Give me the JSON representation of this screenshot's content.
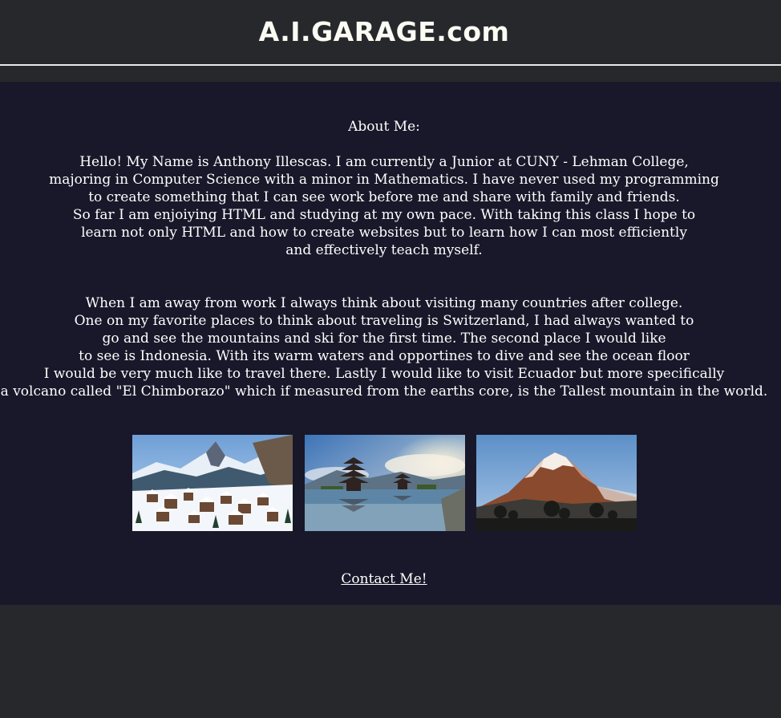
{
  "header": {
    "site_title": "A.I.GARAGE.com"
  },
  "about": {
    "heading": "About Me:",
    "paragraph_1": [
      "Hello! My Name is Anthony Illescas. I am currently a Junior at CUNY - Lehman College,",
      "majoring in Computer Science with a minor in Mathematics. I have never used my programming",
      "to create something that I can see work before me and share with family and friends.",
      "So far I am enjoiying HTML and studying at my own pace. With taking this class I hope to",
      "learn not only HTML and how to create websites but to learn how I can most efficiently",
      "and effectively teach myself."
    ],
    "paragraph_2": [
      "When I am away from work I always think about visiting many countries after college.",
      "One on my favorite places to think about traveling is Switzerland, I had always wanted to",
      "go and see the mountains and ski for the first time. The second place I would like",
      "to see is Indonesia. With its warm waters and opportines to dive and see the ocean floor",
      "I would be very much like to travel there. Lastly I would like to visit Ecuador but more specifically",
      "a volcano called \"El Chimborazo\" which if measured from the earths core, is the Tallest mountain in the world."
    ]
  },
  "contact": {
    "label": "Contact Me!"
  }
}
